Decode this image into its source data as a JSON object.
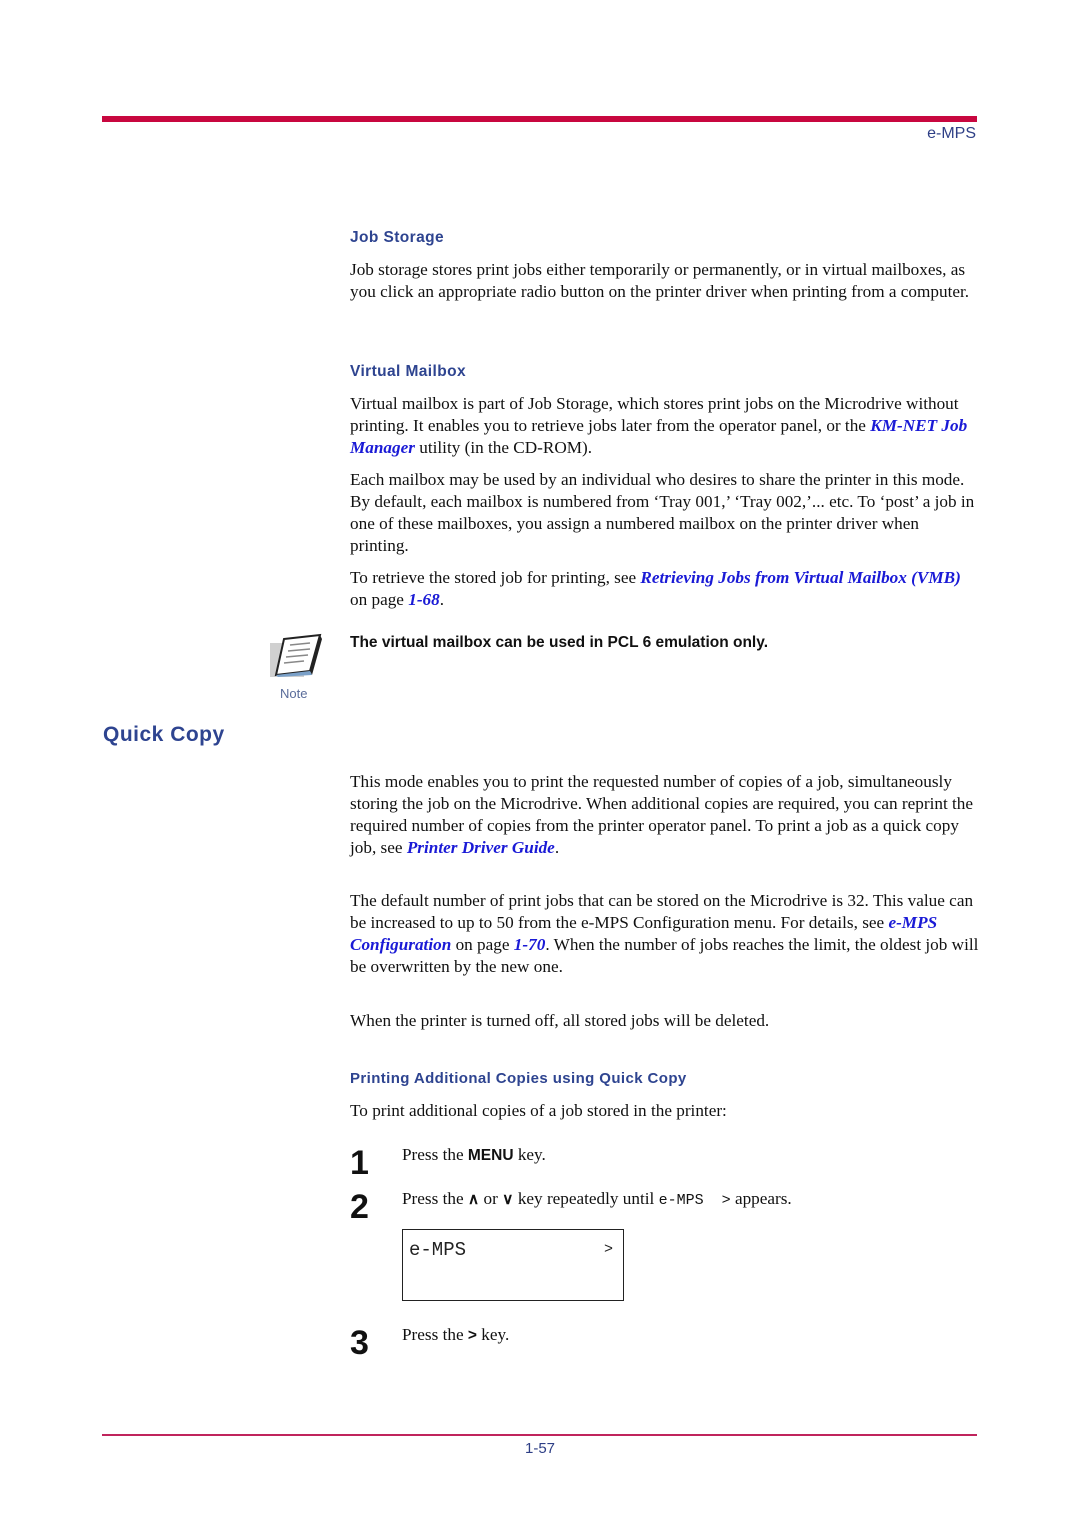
{
  "header": {
    "running_head": "e-MPS"
  },
  "footer": {
    "page_number": "1-57"
  },
  "colors": {
    "rule_top": "#c8073f",
    "rule_bottom": "#c0245c",
    "heading": "#2e4490",
    "link": "#1a1ad6"
  },
  "job_storage": {
    "heading": "Job Storage",
    "body": "Job storage stores print jobs either temporarily or permanently, or in virtual mailboxes, as you click an appropriate radio button on the printer driver when printing from a computer."
  },
  "virtual_mailbox": {
    "heading": "Virtual Mailbox",
    "p1_before": "Virtual mailbox is part of Job Storage, which stores print jobs on the Microdrive without printing. It enables you to retrieve jobs later from the operator panel, or the ",
    "p1_link": "KM-NET Job Manager",
    "p1_after": " utility (in the CD-ROM).",
    "p2": "Each mailbox may be used by an individual who desires to share the printer in this mode. By default, each mailbox is numbered from ‘Tray 001,’ ‘Tray 002,’... etc. To ‘post’ a job in one of these mailboxes, you assign a numbered mailbox on the printer driver when printing.",
    "p3_before": "To retrieve the stored job for printing, see ",
    "p3_link": "Retrieving Jobs from Virtual Mailbox (VMB)",
    "p3_mid": " on page ",
    "p3_page_link": "1-68",
    "p3_after": "."
  },
  "note": {
    "icon": "note-paper-icon",
    "label": "Note",
    "text": "The virtual mailbox can be used in PCL 6 emulation only."
  },
  "quick_copy": {
    "heading": "Quick Copy",
    "p1_before": "This mode enables you to print the requested number of copies of a job, simultaneously storing the job on the Microdrive. When additional copies are required, you can reprint the required number of copies from the printer operator panel. To print a job as a quick copy job, see ",
    "p1_link": "Printer Driver Guide",
    "p1_after": ".",
    "p2_before": "The default number of print jobs that can be stored on the Microdrive is 32. This value can be increased to up to 50 from the e-MPS Configuration menu. For details, see ",
    "p2_link": "e-MPS Configuration",
    "p2_mid": " on page ",
    "p2_page_link": "1-70",
    "p2_after": ". When the number of jobs reaches the limit, the oldest job will be overwritten by the new one.",
    "p3": "When the printer is turned off, all stored jobs will be deleted."
  },
  "additional_copies": {
    "heading": "Printing Additional Copies using Quick Copy",
    "intro": "To print additional copies of a job stored in the printer:",
    "steps": [
      {
        "num": "1",
        "before": "Press the ",
        "key": "MENU",
        "after": " key."
      },
      {
        "num": "2",
        "before": "Press the ",
        "up_key": "∧",
        "or": " or ",
        "down_key": "∨",
        "mid": " key repeatedly until ",
        "display": "e-MPS  >",
        "after": " appears."
      },
      {
        "num": "3",
        "before": "Press the ",
        "key": ">",
        "after": " key."
      }
    ],
    "lcd": {
      "line1": "e-MPS",
      "arrow": ">"
    }
  }
}
